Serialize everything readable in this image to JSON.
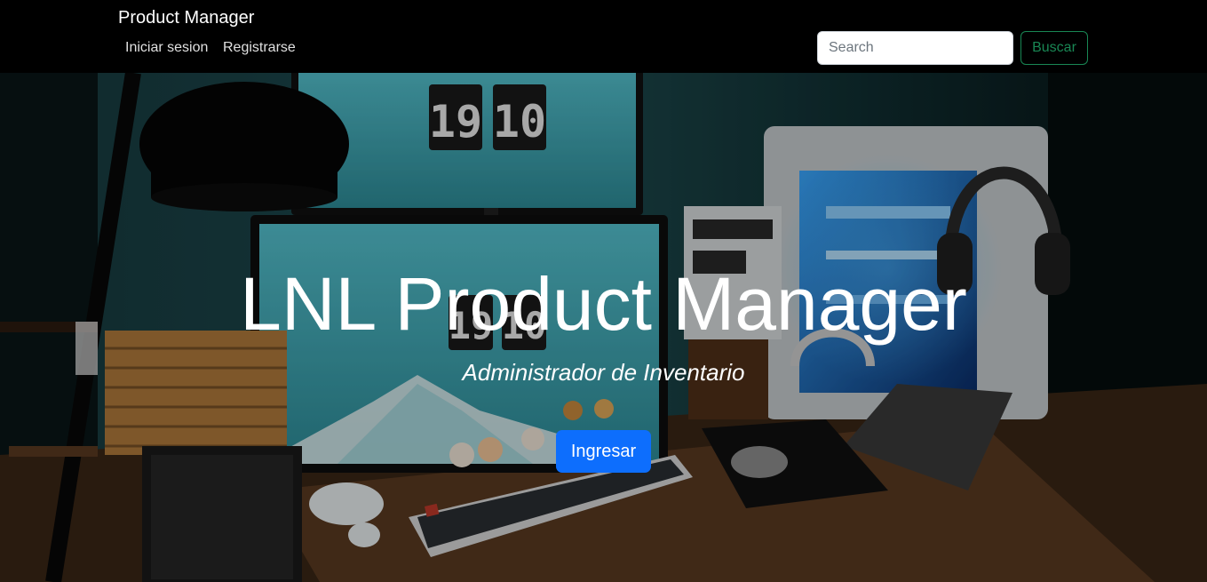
{
  "navbar": {
    "brand": "Product Manager",
    "links": [
      "Iniciar sesion",
      "Registrarse"
    ],
    "search_placeholder": "Search",
    "search_button": "Buscar"
  },
  "hero": {
    "title": "LNL Product Manager",
    "subtitle": "Administrador de Inventario",
    "button": "Ingresar",
    "background_clock_upper": "1910",
    "background_clock_lower": "1910"
  },
  "colors": {
    "navbar_bg": "#000000",
    "primary": "#0d6efd",
    "success": "#198754"
  },
  "icons": {
    "hero_background": "desk-setup-photo"
  }
}
